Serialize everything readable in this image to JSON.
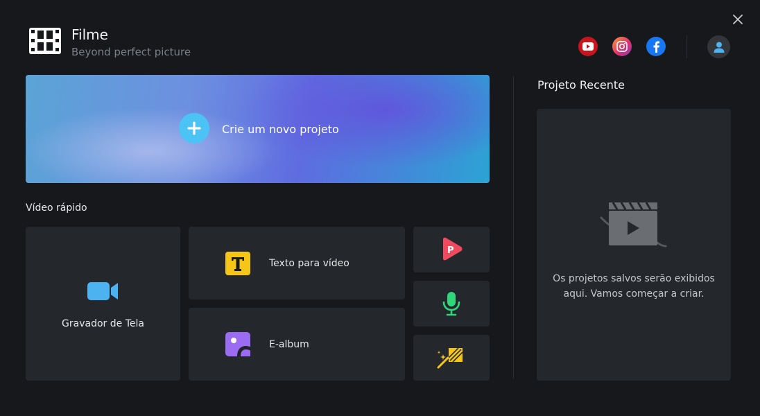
{
  "app": {
    "title": "Filme",
    "subtitle": "Beyond perfect picture",
    "logo_icon": "film-strip-icon"
  },
  "header": {
    "social": [
      {
        "name": "youtube",
        "icon": "youtube-icon",
        "color": "#c8141c"
      },
      {
        "name": "instagram",
        "icon": "instagram-icon",
        "color": "#e1306c"
      },
      {
        "name": "facebook",
        "icon": "facebook-icon",
        "color": "#1877f2"
      }
    ],
    "account_icon": "user-icon",
    "close_icon": "close-icon"
  },
  "create": {
    "label": "Crie um novo projeto",
    "icon": "plus-icon",
    "accent": "#4cc3f5"
  },
  "quick": {
    "title": "Vídeo rápido",
    "items": [
      {
        "label": "Gravador de Tela",
        "icon": "video-camera-icon",
        "color": "#4db2f0"
      },
      {
        "label": "Texto para vídeo",
        "icon": "text-t-icon",
        "color": "#f5c518"
      },
      {
        "label": "E-album",
        "icon": "photo-album-icon",
        "color": "#9b6cf2"
      },
      {
        "label": "",
        "icon": "play-p-icon",
        "color": "#f04a5f"
      },
      {
        "label": "",
        "icon": "microphone-icon",
        "color": "#2fd67a"
      },
      {
        "label": "",
        "icon": "magic-wand-icon",
        "color": "#f5c518"
      }
    ]
  },
  "recent": {
    "title": "Projeto Recente",
    "empty_line1": "Os projetos salvos serão exibidos",
    "empty_line2": "aqui. Vamos começar a criar.",
    "icon": "clapperboard-icon"
  }
}
